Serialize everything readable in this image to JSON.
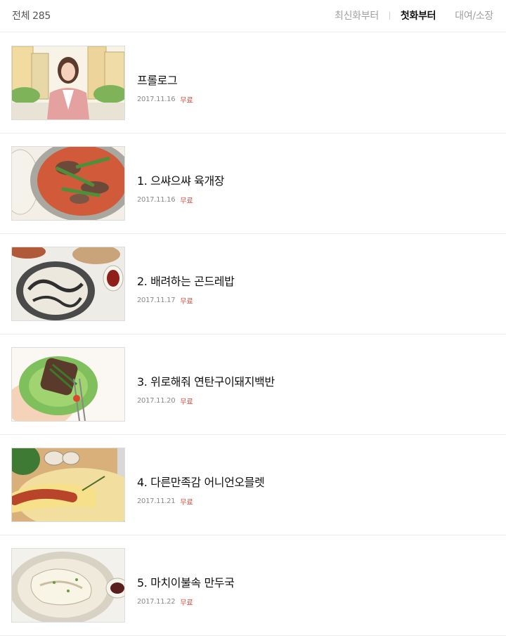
{
  "header": {
    "total_label": "전체",
    "total_count": "285",
    "sort_latest": "최신화부터",
    "sort_first": "첫화부터",
    "rent_own": "대여/소장"
  },
  "episodes": [
    {
      "title": "프롤로그",
      "date": "2017.11.16",
      "price": "무료",
      "thumb": "city-woman"
    },
    {
      "title": "1. 으쌰으쌰 육개장",
      "date": "2017.11.16",
      "price": "무료",
      "thumb": "spicy-stew"
    },
    {
      "title": "2. 배려하는 곤드레밥",
      "date": "2017.11.17",
      "price": "무료",
      "thumb": "gondre-rice"
    },
    {
      "title": "3. 위로해줘 연탄구이돼지백반",
      "date": "2017.11.20",
      "price": "무료",
      "thumb": "lettuce-pork"
    },
    {
      "title": "4. 다른만족감 어니언오믈렛",
      "date": "2017.11.21",
      "price": "무료",
      "thumb": "omelette"
    },
    {
      "title": "5. 마치이불속 만두국",
      "date": "2017.11.22",
      "price": "무료",
      "thumb": "dumpling-soup"
    }
  ],
  "colors": {
    "free": "#e0453a",
    "active_sort": "#111111",
    "inactive": "#a0a0a0"
  }
}
